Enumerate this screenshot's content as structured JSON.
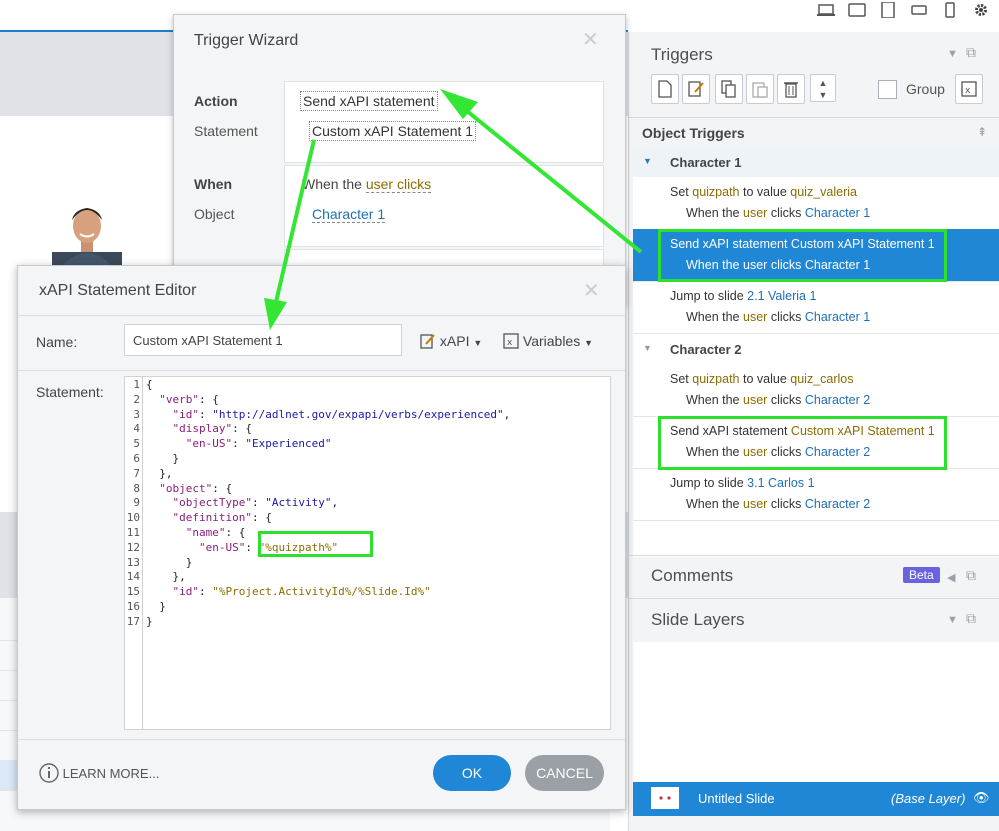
{
  "toolbar": {
    "device_icons": [
      "desktop-icon",
      "tablet-landscape-icon",
      "tablet-portrait-icon",
      "phone-landscape-icon",
      "phone-portrait-icon",
      "gear-icon"
    ]
  },
  "triggers_panel": {
    "title": "Triggers",
    "group_label": "Group",
    "section_title": "Object Triggers",
    "groups": [
      {
        "name": "Character 1",
        "items": [
          {
            "verb": "Set",
            "obj": "quizpath",
            "mid": "to value",
            "val": "quiz_valeria",
            "w1": "When the",
            "w2": "user",
            "w3": "clicks",
            "target": "Character 1"
          },
          {
            "verb": "Send xAPI statement",
            "obj": "Custom xAPI Statement 1",
            "mid": "",
            "val": "",
            "w1": "When the",
            "w2": "user",
            "w3": "clicks",
            "target": "Character 1"
          },
          {
            "verb": "Jump to slide",
            "obj": "2.1 Valeria 1",
            "mid": "",
            "val": "",
            "w1": "When the",
            "w2": "user",
            "w3": "clicks",
            "target": "Character 1"
          }
        ]
      },
      {
        "name": "Character 2",
        "items": [
          {
            "verb": "Set",
            "obj": "quizpath",
            "mid": "to value",
            "val": "quiz_carlos",
            "w1": "When the",
            "w2": "user",
            "w3": "clicks",
            "target": "Character 2"
          },
          {
            "verb": "Send xAPI statement",
            "obj": "Custom xAPI Statement 1",
            "mid": "",
            "val": "",
            "w1": "When the",
            "w2": "user",
            "w3": "clicks",
            "target": "Character 2"
          },
          {
            "verb": "Jump to slide",
            "obj": "3.1 Carlos 1",
            "mid": "",
            "val": "",
            "w1": "When the",
            "w2": "user",
            "w3": "clicks",
            "target": "Character 2"
          }
        ]
      }
    ]
  },
  "comments_panel": {
    "title": "Comments",
    "badge": "Beta"
  },
  "layers_panel": {
    "title": "Slide Layers",
    "slide_name": "Untitled Slide",
    "layer_label": "(Base Layer)"
  },
  "wizard": {
    "title": "Trigger Wizard",
    "action_label": "Action",
    "action_value": "Send xAPI statement",
    "statement_label": "Statement",
    "statement_value": "Custom xAPI Statement 1",
    "when_label": "When",
    "when_prefix": "When the",
    "when_value": "user clicks",
    "object_label": "Object",
    "object_value": "Character 1"
  },
  "editor": {
    "title": "xAPI Statement Editor",
    "name_label": "Name:",
    "name_value": "Custom xAPI Statement 1",
    "xapi_menu": "xAPI",
    "variables_menu": "Variables",
    "statement_label": "Statement:",
    "code_lines": [
      "{",
      "  \"verb\": {",
      "    \"id\": \"http://adlnet.gov/expapi/verbs/experienced\",",
      "    \"display\": {",
      "      \"en-US\": \"Experienced\"",
      "    }",
      "  },",
      "  \"object\": {",
      "    \"objectType\": \"Activity\",",
      "    \"definition\": {",
      "      \"name\": {",
      "        \"en-US\": \"%quizpath%\"",
      "      }",
      "    },",
      "    \"id\": \"%Project.ActivityId%/%Slide.Id%\"",
      "  }",
      "}"
    ],
    "learn_more": "LEARN MORE...",
    "ok": "OK",
    "cancel": "CANCEL"
  },
  "colors": {
    "accent": "#1f87d6",
    "highlight": "#2ee02e",
    "ok_button": "#1f87d6",
    "cancel_button": "#9aa0a6"
  }
}
